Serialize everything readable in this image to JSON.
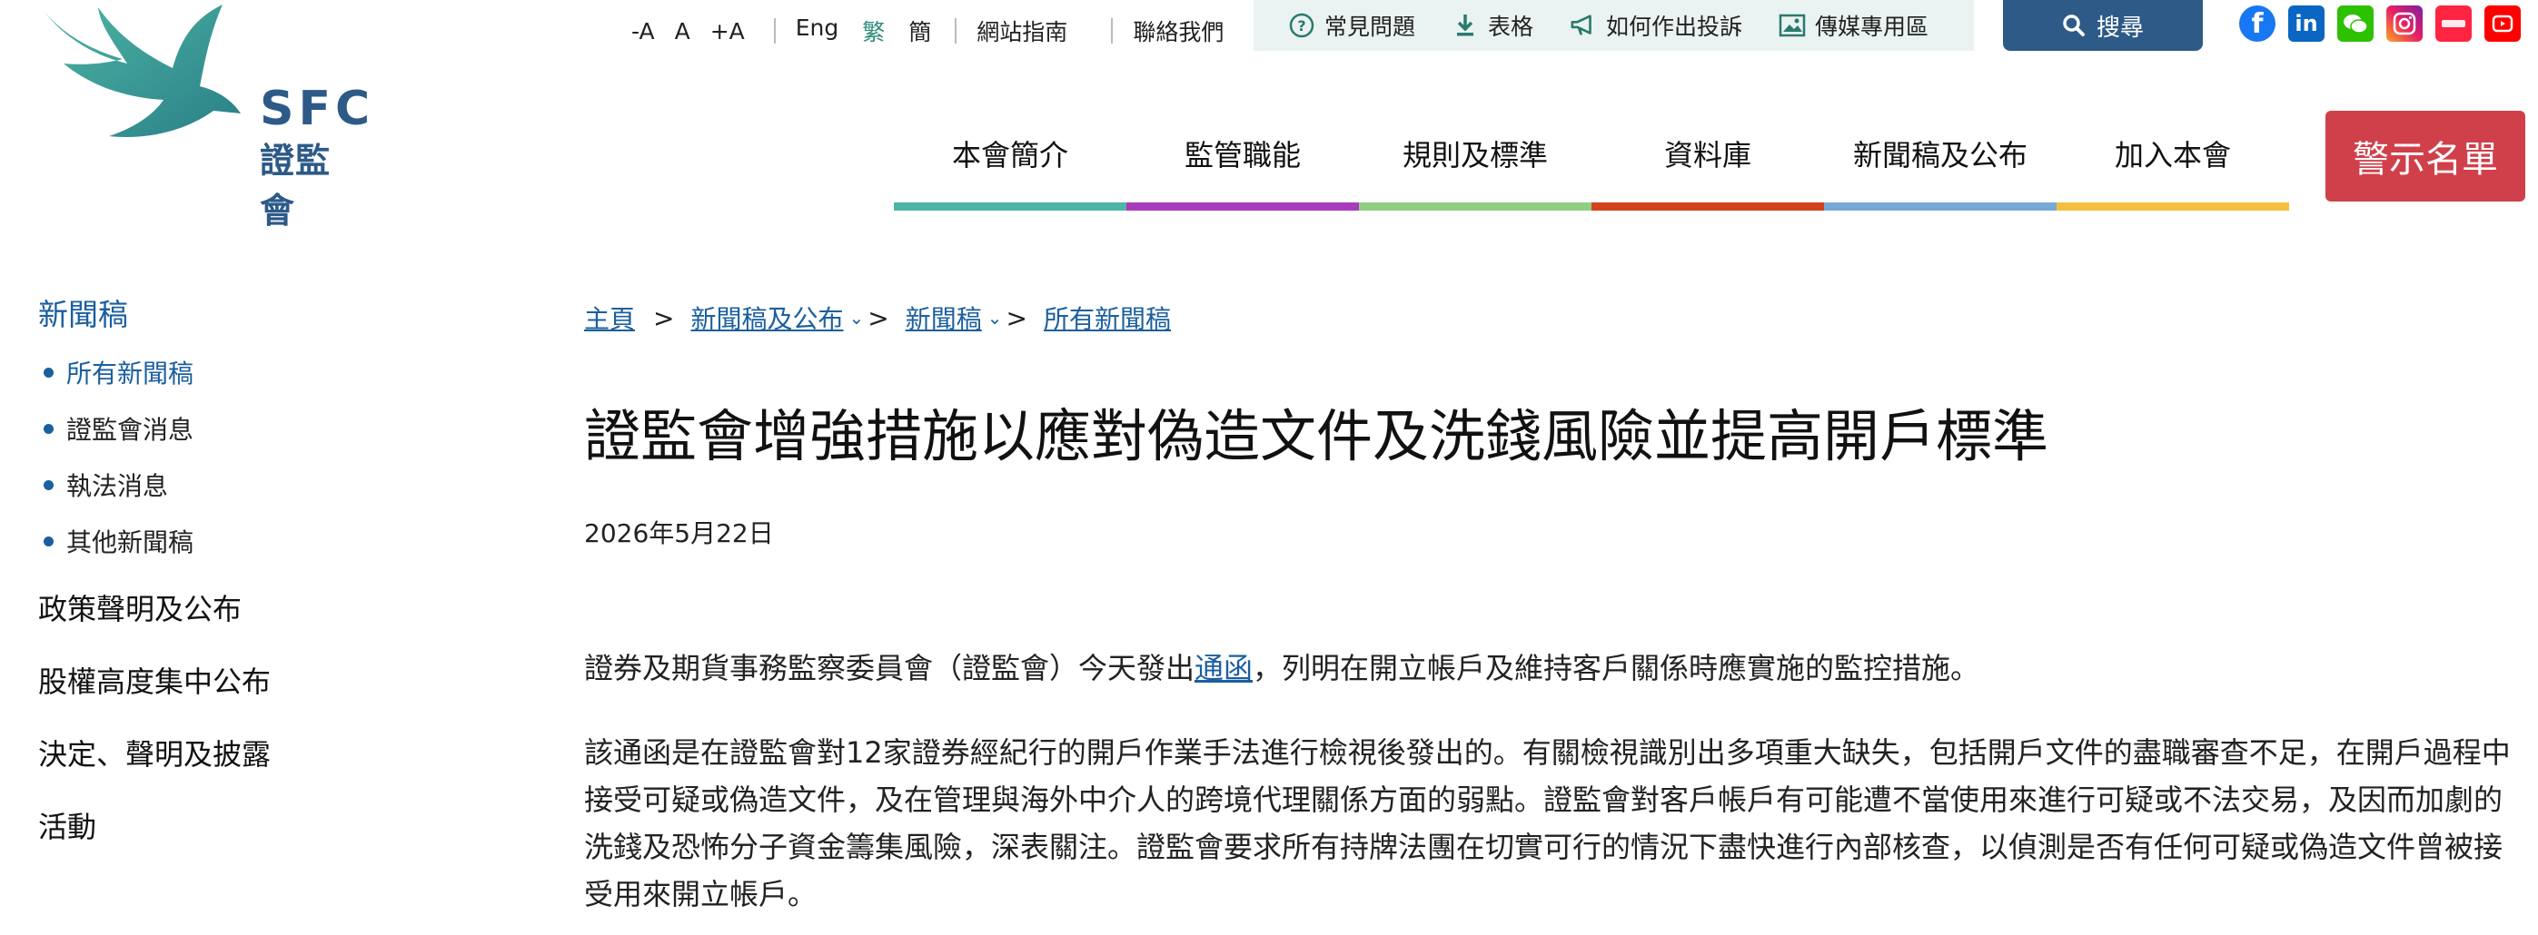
{
  "logo": {
    "abbr": "SFC",
    "cn_name": "證監會"
  },
  "font_controls": [
    "-A",
    "A",
    "+A"
  ],
  "languages": {
    "eng": "Eng",
    "trad": "繁",
    "simp": "簡"
  },
  "util_links": {
    "sitemap": "網站指南",
    "contact": "聯絡我們"
  },
  "quick_links": [
    {
      "icon": "question-circle-icon",
      "label": "常見問題"
    },
    {
      "icon": "download-icon",
      "label": "表格"
    },
    {
      "icon": "megaphone-icon",
      "label": "如何作出投訴"
    },
    {
      "icon": "image-icon",
      "label": "傳媒專用區"
    }
  ],
  "search": {
    "label": "搜尋"
  },
  "social": [
    {
      "name": "facebook-icon",
      "glyph": "f",
      "color": "#1877f2"
    },
    {
      "name": "linkedin-icon",
      "glyph": "in",
      "color": "#0a66c2"
    },
    {
      "name": "wechat-icon",
      "glyph": "",
      "color": "#2dc100"
    },
    {
      "name": "instagram-icon",
      "glyph": "",
      "color": "#d6249f"
    },
    {
      "name": "xiaohongshu-icon",
      "glyph": "",
      "color": "#ff2442"
    },
    {
      "name": "youtube-icon",
      "glyph": "",
      "color": "#ff0000"
    }
  ],
  "nav": [
    {
      "label": "本會簡介",
      "color": "#4fb3a6"
    },
    {
      "label": "監管職能",
      "color": "#a93bbd"
    },
    {
      "label": "規則及標準",
      "color": "#8fcf82"
    },
    {
      "label": "資料庫",
      "color": "#d2421f"
    },
    {
      "label": "新聞稿及公布",
      "color": "#76a9d8"
    },
    {
      "label": "加入本會",
      "color": "#f4bf3f"
    }
  ],
  "alert_button": "警示名單",
  "sidebar": {
    "heading": "新聞稿",
    "subitems": [
      "所有新聞稿",
      "證監會消息",
      "執法消息",
      "其他新聞稿"
    ],
    "sections": [
      "政策聲明及公布",
      "股權高度集中公布",
      "決定、聲明及披露",
      "活動"
    ]
  },
  "breadcrumb": {
    "home": "主頁",
    "sep": ">",
    "level1": "新聞稿及公布",
    "level2": "新聞稿",
    "level3": "所有新聞稿"
  },
  "article": {
    "title": "證監會增強措施以應對偽造文件及洗錢風險並提高開戶標準",
    "date": "2026年5月22日",
    "p1_before": "證券及期貨事務監察委員會（證監會）今天發出",
    "p1_link": "通函",
    "p1_after": "，列明在開立帳戶及維持客戶關係時應實施的監控措施。",
    "p2": "該通函是在證監會對12家證券經紀行的開戶作業手法進行檢視後發出的。有關檢視識別出多項重大缺失，包括開戶文件的盡職審查不足，在開戶過程中接受可疑或偽造文件，及在管理與海外中介人的跨境代理關係方面的弱點。證監會對客戶帳戶有可能遭不當使用來進行可疑或不法交易，及因而加劇的洗錢及恐怖分子資金籌集風險，深表關注。證監會要求所有持牌法團在切實可行的情況下盡快進行內部核查，以偵測是否有任何可疑或偽造文件曾被接受用來開立帳戶。"
  }
}
